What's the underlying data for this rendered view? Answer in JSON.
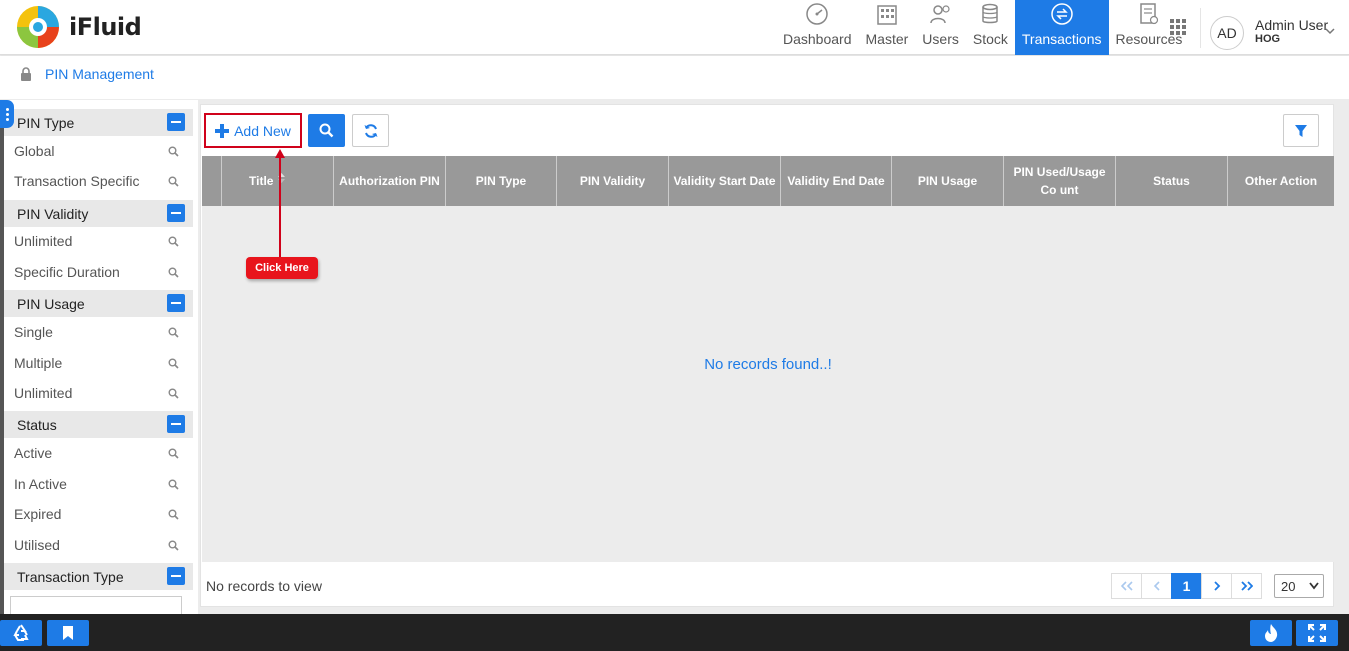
{
  "app": {
    "name": "iFluid"
  },
  "nav": {
    "items": [
      {
        "label": "Dashboard",
        "icon": "speedometer-icon",
        "active": false
      },
      {
        "label": "Master",
        "icon": "building-icon",
        "active": false
      },
      {
        "label": "Users",
        "icon": "users-icon",
        "active": false
      },
      {
        "label": "Stock",
        "icon": "coins-stack-icon",
        "active": false
      },
      {
        "label": "Transactions",
        "icon": "exchange-icon",
        "active": true
      },
      {
        "label": "Resources",
        "icon": "document-icon",
        "active": false
      }
    ]
  },
  "user": {
    "initials": "AD",
    "name": "Admin User",
    "role": "HOG"
  },
  "breadcrumb": {
    "title": "PIN Management"
  },
  "sidebar": {
    "groups": [
      {
        "title": "PIN Type",
        "items": [
          "Global",
          "Transaction Specific"
        ]
      },
      {
        "title": "PIN Validity",
        "items": [
          "Unlimited",
          "Specific Duration"
        ]
      },
      {
        "title": "PIN Usage",
        "items": [
          "Single",
          "Multiple",
          "Unlimited"
        ]
      },
      {
        "title": "Status",
        "items": [
          "Active",
          "In Active",
          "Expired",
          "Utilised"
        ]
      },
      {
        "title": "Transaction Type",
        "items": []
      }
    ]
  },
  "toolbar": {
    "add_label": "Add New"
  },
  "table": {
    "columns": [
      "Title",
      "Authorization PIN",
      "PIN Type",
      "PIN Validity",
      "Validity Start Date",
      "Validity End Date",
      "PIN Usage",
      "PIN Used/Usage Co unt",
      "Status",
      "Other Action"
    ],
    "empty_message": "No records found..!",
    "footer_text": "No records to view"
  },
  "pagination": {
    "current_page": "1",
    "page_size": "20"
  },
  "callout": {
    "text": "Click Here"
  },
  "colors": {
    "accent": "#1e7be6",
    "highlight": "#d0021b",
    "header_gray": "#999999"
  }
}
